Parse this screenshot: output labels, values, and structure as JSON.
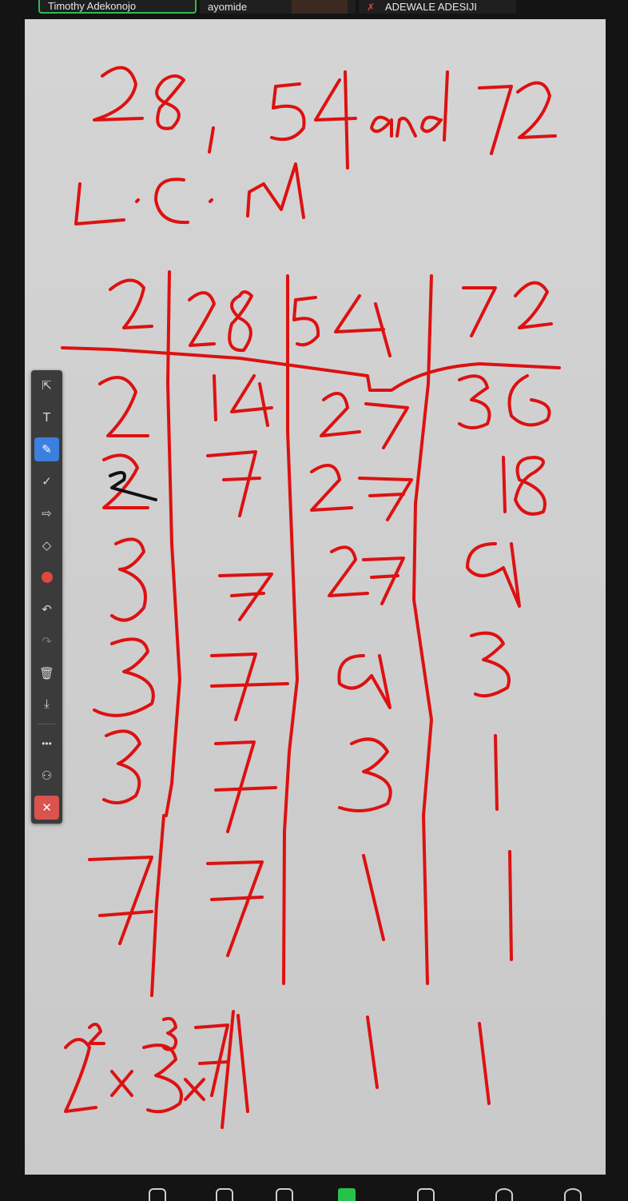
{
  "participants": [
    {
      "name": "Timothy Adekonojo",
      "active": true,
      "muted": false
    },
    {
      "name": "ayomide",
      "active": false,
      "muted": false
    },
    {
      "name": "ADEWALE ADESIJI",
      "active": false,
      "muted": true
    }
  ],
  "toolbar": {
    "tools": [
      {
        "name": "select-icon",
        "glyph": "⇱"
      },
      {
        "name": "text-icon",
        "glyph": "T"
      },
      {
        "name": "pen-icon",
        "glyph": "✎",
        "selected": true
      },
      {
        "name": "stamp-check-icon",
        "glyph": "✓"
      },
      {
        "name": "spotlight-arrow-icon",
        "glyph": "⇨"
      },
      {
        "name": "eraser-icon",
        "glyph": "◇"
      },
      {
        "name": "color-icon",
        "glyph": ""
      },
      {
        "name": "undo-icon",
        "glyph": "↶"
      },
      {
        "name": "redo-icon",
        "glyph": "↷"
      },
      {
        "name": "clear-icon",
        "glyph": "🗑"
      },
      {
        "name": "save-icon",
        "glyph": "⤓"
      },
      {
        "name": "more-icon",
        "glyph": "•••"
      },
      {
        "name": "annotator-name-icon",
        "glyph": "⚇"
      },
      {
        "name": "close-icon",
        "glyph": "✕"
      }
    ],
    "active_color": "#e0473e"
  },
  "ink_color": "#dd1111",
  "whiteboard": {
    "handwriting": "28, 54 and 72 — L.C.M — division table: 2|28 54 72; 2|14 27 36; 2|7 27 18; 3|7 27 9; 3|7 9 3; 3|7 3 1; 7|7 1 1; 2²×3³×7 | 1 1 1"
  }
}
